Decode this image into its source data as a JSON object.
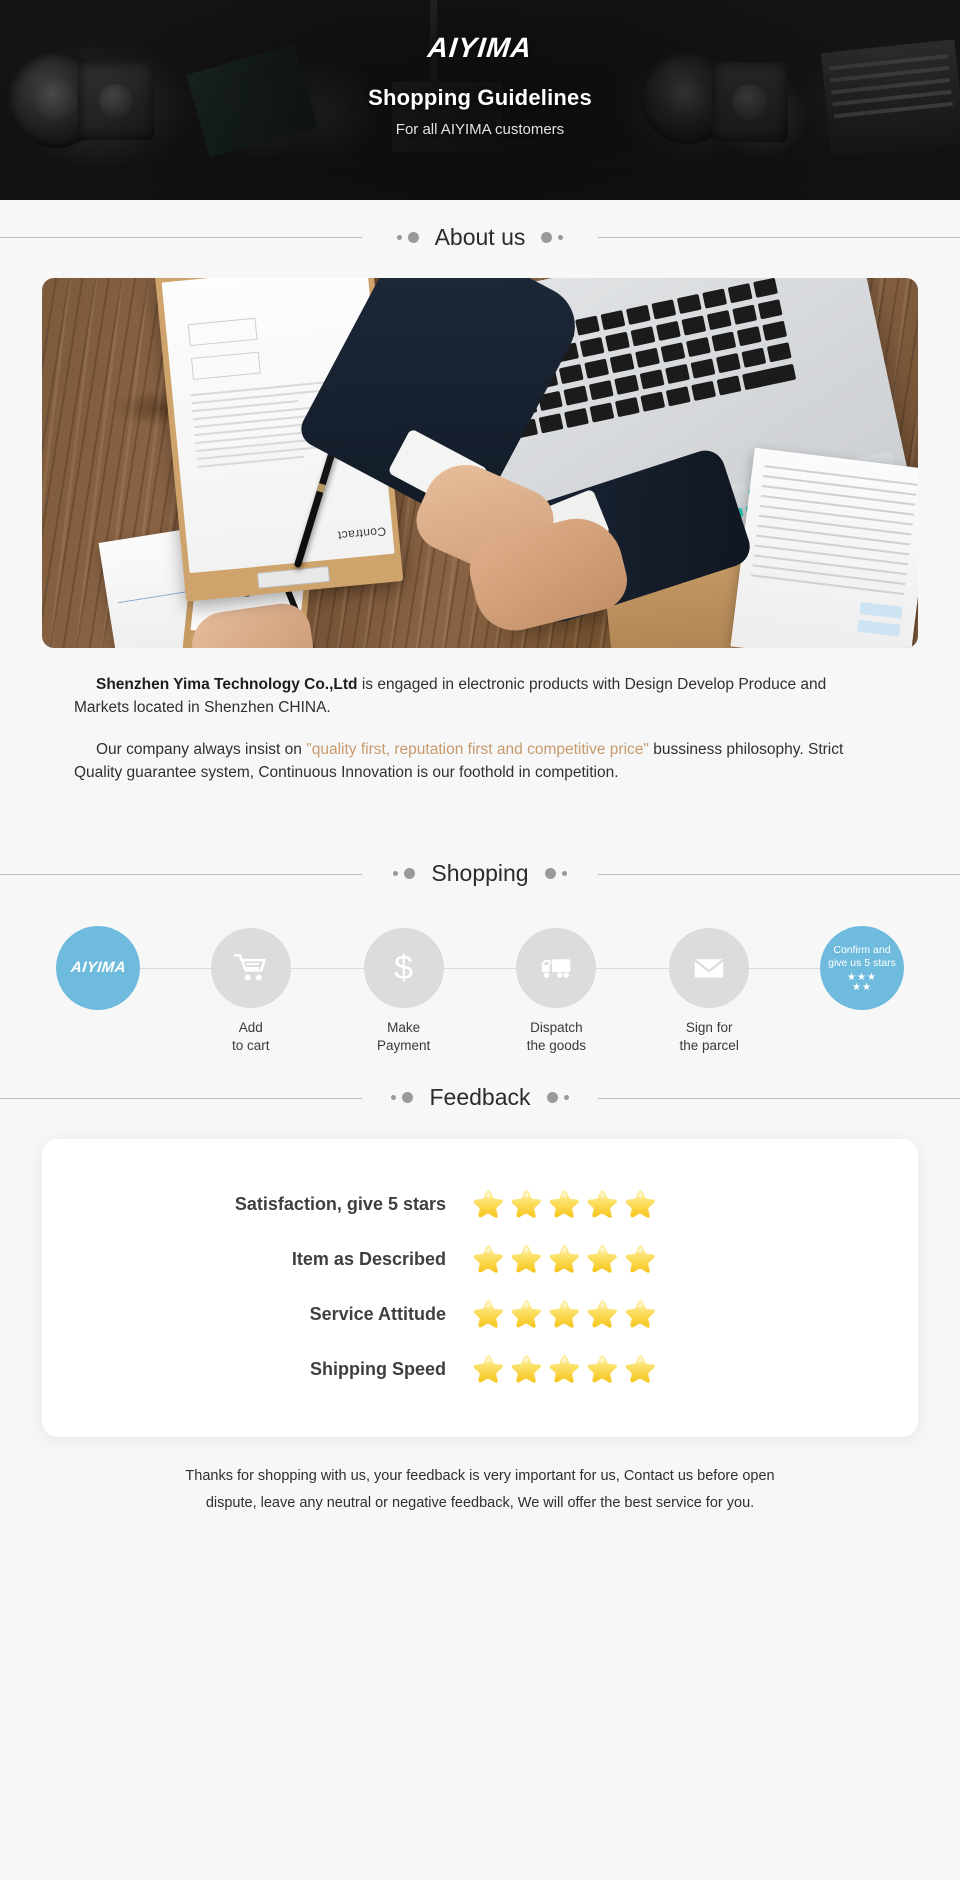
{
  "hero": {
    "logo": "AIYIMA",
    "title": "Shopping Guidelines",
    "subtitle": "For all AIYIMA customers"
  },
  "sections": {
    "about_title": "About us",
    "shopping_title": "Shopping",
    "feedback_title": "Feedback"
  },
  "about": {
    "paragraph1_strong": "Shenzhen Yima Technology Co.,Ltd",
    "paragraph1_rest": " is engaged in electronic products with Design Develop Produce and Markets located in Shenzhen CHINA.",
    "paragraph2_start": "Our company always insist on ",
    "paragraph2_quote": "\"quality first, reputation first and competitive price\"",
    "paragraph2_end": " bussiness philosophy. Strict Quality guarantee system, Continuous Innovation is our foothold in competition.",
    "image_alt": "business handshake over wooden desk with contract clipboard and laptop"
  },
  "shopping_steps": [
    {
      "id": "brand",
      "icon": "aiyima-logo-icon",
      "brand_text": "AIYIMA",
      "label": ""
    },
    {
      "id": "add-to-cart",
      "icon": "shopping-cart-icon",
      "label": "Add\nto cart"
    },
    {
      "id": "make-payment",
      "icon": "dollar-icon",
      "label": "Make\nPayment"
    },
    {
      "id": "dispatch-goods",
      "icon": "delivery-truck-icon",
      "label": "Dispatch\nthe goods"
    },
    {
      "id": "sign-parcel",
      "icon": "envelope-icon",
      "label": "Sign for\nthe parcel"
    },
    {
      "id": "confirm-rate",
      "icon": "five-stars-icon",
      "label": "",
      "inner_text": "Confirm and\ngive us 5 stars",
      "stars_top": "★★★",
      "stars_bottom": "★★"
    }
  ],
  "feedback_rows": [
    {
      "label": "Satisfaction, give 5 stars",
      "stars": 5
    },
    {
      "label": "Item as Described",
      "stars": 5
    },
    {
      "label": "Service Attitude",
      "stars": 5
    },
    {
      "label": "Shipping Speed",
      "stars": 5
    }
  ],
  "footer": {
    "line1": "Thanks for shopping with us, your feedback is very important for us, Contact us before open",
    "line2": "dispute, leave any neutral or negative feedback, We will offer the best service for you."
  },
  "colors": {
    "accent_blue": "#6fbbdd",
    "quote_brown": "#c79a6e",
    "star_gold": "#f5d33c",
    "page_bg": "#f7f7f7",
    "hero_bg": "#141414",
    "circle_grey": "#dcdcdc"
  }
}
